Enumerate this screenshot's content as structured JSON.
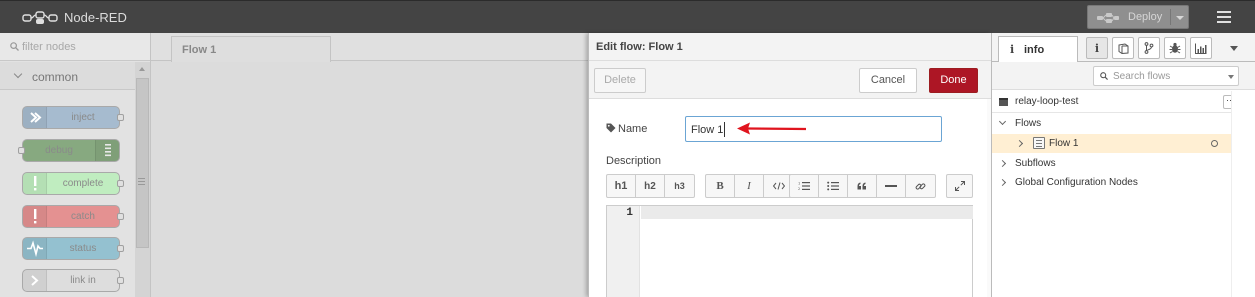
{
  "header": {
    "app_title": "Node-RED",
    "deploy_label": "Deploy"
  },
  "palette": {
    "search_placeholder": "filter nodes",
    "category": "common",
    "nodes": [
      {
        "label": "inject",
        "color": "#a6bbcf"
      },
      {
        "label": "debug",
        "color": "#87a980"
      },
      {
        "label": "complete",
        "color": "#c0edc0"
      },
      {
        "label": "catch",
        "color": "#e49191"
      },
      {
        "label": "status",
        "color": "#94c1d0"
      },
      {
        "label": "link in",
        "color": "#dddddd"
      }
    ]
  },
  "workspace": {
    "tab_label": "Flow 1"
  },
  "edit_tray": {
    "title": "Edit flow: Flow 1",
    "delete_label": "Delete",
    "cancel_label": "Cancel",
    "done_label": "Done",
    "name_label": "Name",
    "name_value": "Flow 1",
    "description_label": "Description",
    "toolbar": {
      "h1": "h1",
      "h2": "h2",
      "h3": "h3",
      "bold": "B",
      "italic": "I"
    },
    "editor_line_number": "1",
    "accent_color": "#ad1625",
    "arrow_color": "#e0141e"
  },
  "sidebar": {
    "active_tab_label": "info",
    "search_placeholder": "Search flows",
    "project_name": "relay-loop-test",
    "project_menu": "···",
    "tree": {
      "flows_label": "Flows",
      "flow_item": "Flow 1",
      "subflows_label": "Subflows",
      "global_config_label": "Global Configuration Nodes"
    },
    "selected_row_color": "#ffefd3"
  }
}
